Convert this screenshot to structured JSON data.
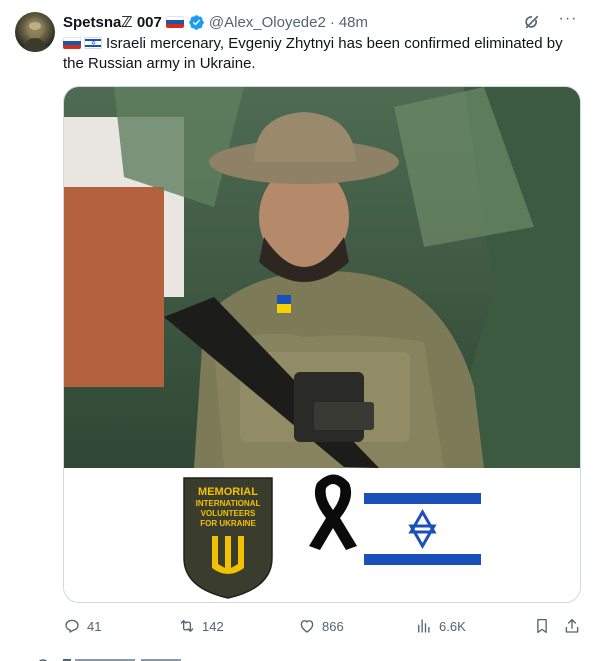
{
  "author": {
    "display_name": "Spetsnaℤ 007",
    "handle": "@Alex_Oloyede2",
    "separator": "·",
    "time": "48m"
  },
  "tweet": {
    "text": "Israeli mercenary, Evgeniy Zhytnyi has been confirmed eliminated by the Russian army in Ukraine."
  },
  "media": {
    "badge_lines": [
      "MEMORIAL",
      "INTERNATIONAL",
      "VOLUNTEERS",
      "FOR UKRAINE"
    ]
  },
  "actions": {
    "replies": "41",
    "reposts": "142",
    "likes": "866",
    "views": "6.6K"
  },
  "icons": [
    "verified-badge-icon",
    "grok-icon",
    "more-icon",
    "reply-icon",
    "repost-icon",
    "like-icon",
    "views-icon",
    "bookmark-icon",
    "share-icon",
    "russia-flag-icon",
    "israel-flag-icon"
  ],
  "colors": {
    "verified_blue": "#1d9bf0",
    "secondary_text": "#536471",
    "israel_blue": "#1a50b8"
  }
}
